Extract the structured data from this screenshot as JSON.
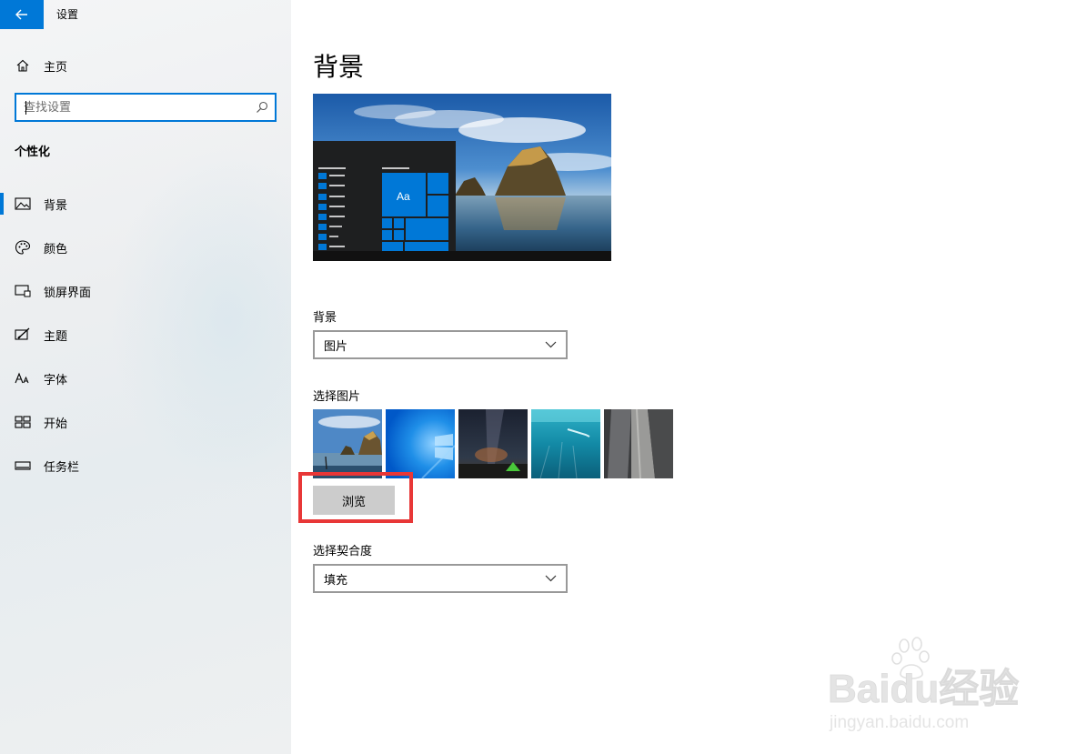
{
  "window": {
    "title": "设置"
  },
  "sidebar": {
    "home_label": "主页",
    "search_placeholder": "查找设置",
    "section_title": "个性化",
    "items": [
      {
        "label": "背景",
        "icon": "picture-icon",
        "active": true
      },
      {
        "label": "颜色",
        "icon": "palette-icon",
        "active": false
      },
      {
        "label": "锁屏界面",
        "icon": "lock-screen-icon",
        "active": false
      },
      {
        "label": "主题",
        "icon": "theme-icon",
        "active": false
      },
      {
        "label": "字体",
        "icon": "font-icon",
        "active": false
      },
      {
        "label": "开始",
        "icon": "start-icon",
        "active": false
      },
      {
        "label": "任务栏",
        "icon": "taskbar-icon",
        "active": false
      }
    ]
  },
  "main": {
    "title": "背景",
    "preview": {
      "tile_label": "Aa"
    },
    "background_label": "背景",
    "background_value": "图片",
    "choose_picture_label": "选择图片",
    "thumbnails": [
      "beach-rock-thumbnail",
      "windows-blue-thumbnail",
      "night-sky-thumbnail",
      "underwater-thumbnail",
      "rock-cliff-thumbnail"
    ],
    "browse_label": "浏览",
    "fit_label": "选择契合度",
    "fit_value": "填充"
  },
  "watermark": {
    "text": "Baidu经验",
    "url_text": "jingyan.baidu.com"
  },
  "colors": {
    "accent": "#0078d7",
    "highlight": "#e83737",
    "button_bg": "#cccccc"
  }
}
